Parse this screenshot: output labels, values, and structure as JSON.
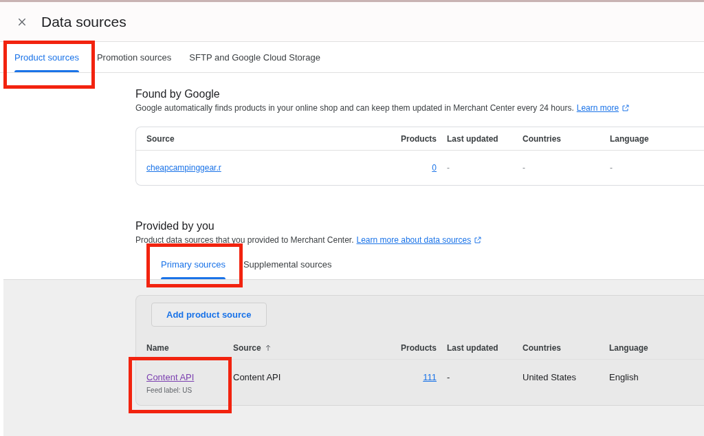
{
  "window": {
    "title": "Data sources"
  },
  "tabs": [
    {
      "label": "Product sources",
      "selected": true,
      "highlighted": true
    },
    {
      "label": "Promotion sources",
      "selected": false,
      "highlighted": false
    },
    {
      "label": "SFTP and Google Cloud Storage",
      "selected": false,
      "highlighted": false
    }
  ],
  "found_by_google": {
    "heading": "Found by Google",
    "description": "Google automatically finds products in your online shop and can keep them updated in Merchant Center every 24 hours.",
    "link": "Learn more",
    "table": {
      "columns": [
        "Source",
        "Products",
        "Last updated",
        "Countries",
        "Language"
      ],
      "rows": [
        {
          "source": "cheapcampinggear.r",
          "products": "0",
          "last_updated": "-",
          "countries": "-",
          "language": "-"
        }
      ]
    }
  },
  "provided_by_you": {
    "heading": "Provided by you",
    "description": "Product data sources that you provided to Merchant Center.",
    "link": "Learn more about data sources",
    "tabs": [
      {
        "label": "Primary sources",
        "selected": true,
        "highlighted": true
      },
      {
        "label": "Supplemental sources",
        "selected": false,
        "highlighted": false
      }
    ],
    "add_button": "Add product source",
    "table": {
      "columns": [
        {
          "label": "Name",
          "sorted": false
        },
        {
          "label": "Source",
          "sorted": true
        },
        {
          "label": "Products",
          "sorted": false
        },
        {
          "label": "Last updated",
          "sorted": false
        },
        {
          "label": "Countries",
          "sorted": false
        },
        {
          "label": "Language",
          "sorted": false
        }
      ],
      "rows": [
        {
          "name": "Content API",
          "feed_label": "Feed label: US",
          "source": "Content API",
          "products": "111",
          "last_updated": "-",
          "countries": "United States",
          "language": "English",
          "highlighted": true
        }
      ]
    }
  }
}
